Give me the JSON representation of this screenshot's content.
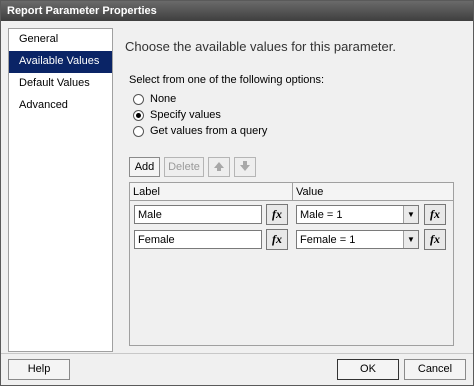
{
  "window": {
    "title": "Report Parameter Properties"
  },
  "sidebar": {
    "items": [
      {
        "label": "General",
        "active": false
      },
      {
        "label": "Available Values",
        "active": true
      },
      {
        "label": "Default Values",
        "active": false
      },
      {
        "label": "Advanced",
        "active": false
      }
    ]
  },
  "main": {
    "heading": "Choose the available values for this parameter.",
    "options_label": "Select from one of the following options:",
    "options": [
      {
        "label": "None",
        "checked": false
      },
      {
        "label": "Specify values",
        "checked": true
      },
      {
        "label": "Get values from a query",
        "checked": false
      }
    ]
  },
  "toolbar": {
    "add_label": "Add",
    "delete_label": "Delete",
    "move_up_icon": "arrow-up-icon",
    "move_down_icon": "arrow-down-icon"
  },
  "grid": {
    "columns": [
      "Label",
      "Value"
    ],
    "rows": [
      {
        "label": "Male",
        "value": "Male = 1"
      },
      {
        "label": "Female",
        "value": "Female = 1"
      }
    ],
    "expression_button": "fx"
  },
  "footer": {
    "help_label": "Help",
    "ok_label": "OK",
    "cancel_label": "Cancel"
  }
}
